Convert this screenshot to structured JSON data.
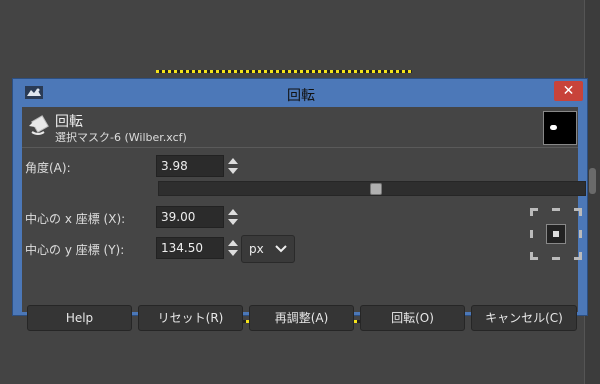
{
  "dialog": {
    "title": "回転",
    "close_label": "✕",
    "header_title": "回転",
    "header_subtitle": "選択マスク-6 (Wilber.xcf)"
  },
  "fields": {
    "angle_label": "角度(A):",
    "angle_value": "3.98",
    "center_x_label": "中心の x 座標 (X):",
    "center_x_value": "39.00",
    "center_y_label": "中心の y 座標 (Y):",
    "center_y_value": "134.50",
    "unit_value": "px"
  },
  "slider": {
    "level": 0.51
  },
  "buttons": {
    "help": "Help",
    "reset": "リセット(R)",
    "readjust": "再調整(A)",
    "rotate": "回転(O)",
    "cancel": "キャンセル(C)"
  },
  "colors": {
    "titlebar": "#4c78b8",
    "close": "#c8433a",
    "panel": "#454545",
    "selection_dash": "#f3e21a"
  },
  "icons": [
    "gimp-wilber-icon",
    "rotate-tool-icon",
    "chevron-down-icon",
    "pivot-grid-icon"
  ]
}
